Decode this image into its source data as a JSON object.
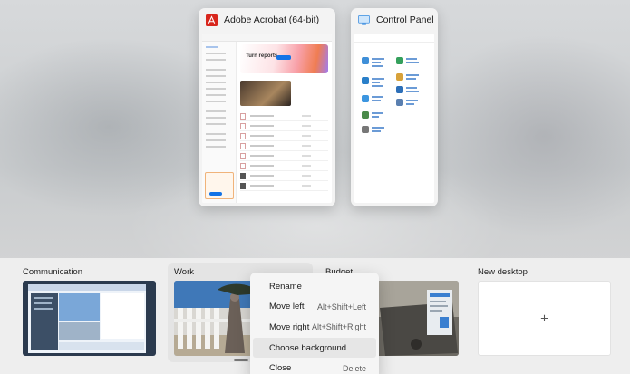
{
  "windows": [
    {
      "title": "Adobe Acrobat (64-bit)",
      "icon": "acrobat-icon"
    },
    {
      "title": "Control Panel",
      "icon": "control-panel-icon"
    }
  ],
  "desktops": [
    {
      "name": "Communication"
    },
    {
      "name": "Work"
    },
    {
      "name": "Budget"
    },
    {
      "name": "New desktop",
      "plus": "+"
    }
  ],
  "context_menu": {
    "items": [
      {
        "label": "Rename",
        "shortcut": ""
      },
      {
        "label": "Move left",
        "shortcut": "Alt+Shift+Left"
      },
      {
        "label": "Move right",
        "shortcut": "Alt+Shift+Right"
      },
      {
        "label": "Choose background",
        "shortcut": ""
      },
      {
        "label": "Close",
        "shortcut": "Delete"
      }
    ],
    "highlighted": "Choose background"
  },
  "colors": {
    "acrobat_red": "#d8261d",
    "accent_blue": "#1473e6"
  }
}
